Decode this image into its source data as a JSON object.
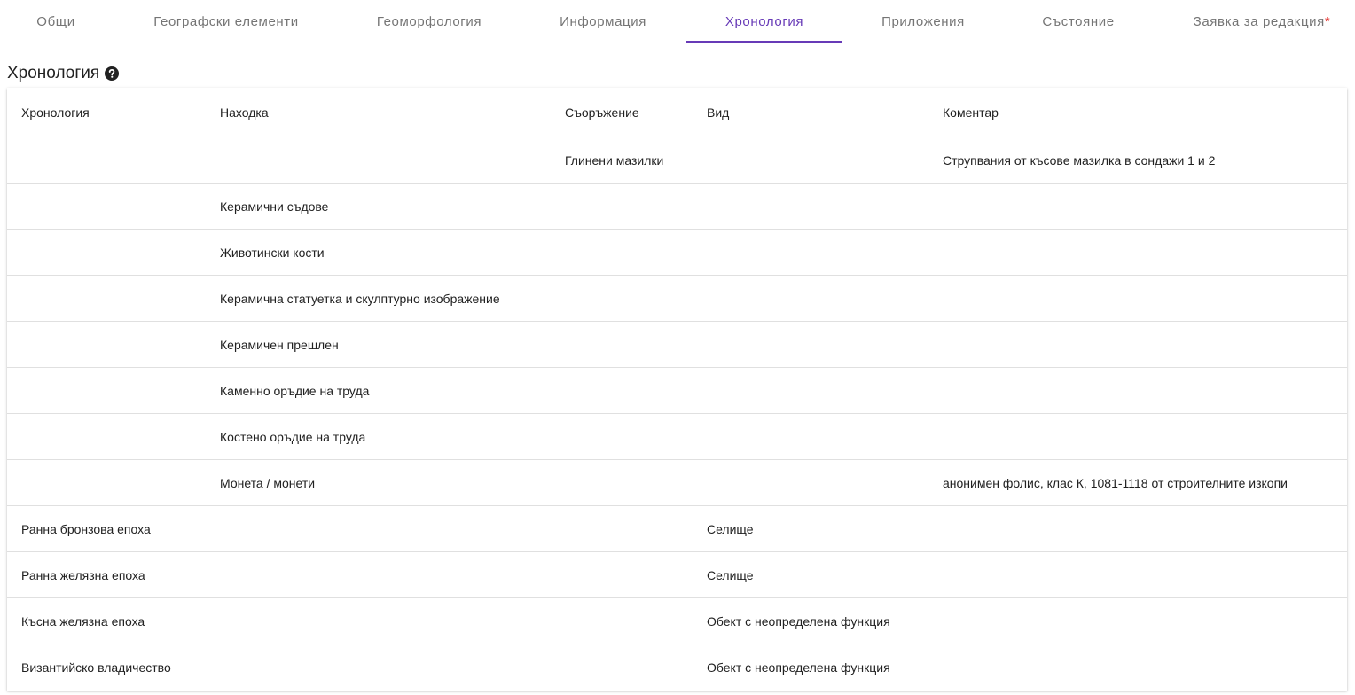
{
  "tabs": [
    {
      "label": "Общи"
    },
    {
      "label": "Географски елементи"
    },
    {
      "label": "Геоморфология"
    },
    {
      "label": "Информация"
    },
    {
      "label": "Хронология",
      "active": true
    },
    {
      "label": "Приложения"
    },
    {
      "label": "Състояние"
    },
    {
      "label": "Заявка за редакция",
      "required_marker": "*"
    }
  ],
  "section": {
    "title": "Хронология",
    "help_icon": "question-circle-icon"
  },
  "table": {
    "columns": [
      "Хронология",
      "Находка",
      "Съоръжение",
      "Вид",
      "Коментар"
    ],
    "rows": [
      [
        "",
        "",
        "Глинени мазилки",
        "",
        "Струпвания от късове мазилка в сондажи 1 и 2"
      ],
      [
        "",
        "Керамични съдове",
        "",
        "",
        ""
      ],
      [
        "",
        "Животински кости",
        "",
        "",
        ""
      ],
      [
        "",
        "Керамична статуетка и скулптурно изображение",
        "",
        "",
        ""
      ],
      [
        "",
        "Керамичен прешлен",
        "",
        "",
        ""
      ],
      [
        "",
        "Каменно оръдие на труда",
        "",
        "",
        ""
      ],
      [
        "",
        "Костено оръдие на труда",
        "",
        "",
        ""
      ],
      [
        "",
        "Монета / монети",
        "",
        "",
        "анонимен фолис, клас К, 1081-1118 от строителните изкопи"
      ],
      [
        "Ранна бронзова епоха",
        "",
        "",
        "Селище",
        ""
      ],
      [
        "Ранна желязна епоха",
        "",
        "",
        "Селище",
        ""
      ],
      [
        "Късна желязна епоха",
        "",
        "",
        "Обект с неопределена функция",
        ""
      ],
      [
        "Византийско владичество",
        "",
        "",
        "Обект с неопределена функция",
        ""
      ]
    ]
  },
  "colors": {
    "accent": "#673ab7",
    "tab_text": "#757575",
    "required": "#e53935",
    "divider": "#e0e0e0"
  }
}
